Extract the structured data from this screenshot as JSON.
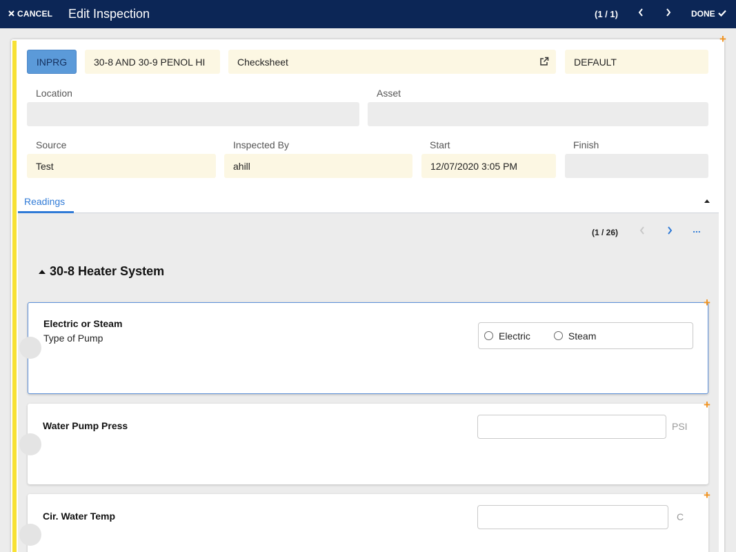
{
  "header": {
    "cancel_label": "CANCEL",
    "title": "Edit Inspection",
    "counter": "(1 / 1)",
    "done_label": "DONE"
  },
  "form": {
    "status": "INPRG",
    "description": "30-8 AND 30-9 PENOL HI",
    "template": "Checksheet",
    "site": "DEFAULT",
    "location_label": "Location",
    "location_value": "",
    "asset_label": "Asset",
    "asset_value": "",
    "source_label": "Source",
    "source_value": "Test",
    "inspected_by_label": "Inspected By",
    "inspected_by_value": "ahill",
    "start_label": "Start",
    "start_value": "12/07/2020 3:05 PM",
    "finish_label": "Finish",
    "finish_value": ""
  },
  "tabs": [
    {
      "label": "Readings",
      "active": true
    }
  ],
  "readings": {
    "counter": "(1 / 26)",
    "more_label": "...",
    "section_title": "30-8 Heater System",
    "items": [
      {
        "title": "Electric or Steam",
        "subtitle": "Type of Pump",
        "options": [
          "Electric",
          "Steam"
        ]
      },
      {
        "title": "Water Pump Press",
        "unit": "PSI",
        "value": ""
      },
      {
        "title": "Cir. Water Temp",
        "unit": "C",
        "value": ""
      }
    ]
  },
  "colors": {
    "header_bg": "#0c2656",
    "accent": "#2f7ad6",
    "status_bg": "#5b9ad9",
    "field_cream": "#fcf7e3",
    "indicator_yellow": "#f7e135",
    "plus_orange": "#f0921e"
  },
  "icons": {
    "cancel": "close-icon",
    "prev": "chevron-left-icon",
    "next": "chevron-right-icon",
    "done": "check-icon",
    "external": "external-link-icon",
    "add": "plus-icon",
    "collapse": "caret-up-icon"
  }
}
